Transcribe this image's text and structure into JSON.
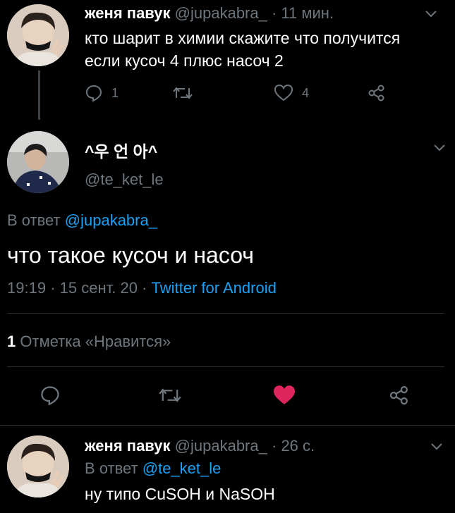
{
  "tweet1": {
    "name": "женя павук",
    "handle": "@jupakabra_",
    "separator": "·",
    "time": "11 мин.",
    "text_line1": "кто шарит в химии скажите что получится",
    "text_line2": "если кусоч 4 плюс насоч 2",
    "reply_count": "1",
    "like_count": "4"
  },
  "main_tweet": {
    "name": "^우 언 아^",
    "handle": "@te_ket_le",
    "reply_prefix": "В ответ",
    "reply_to": "@jupakabra_",
    "text": "что такое кусоч и насоч",
    "time": "19:19",
    "dot1": "·",
    "date": "15 сент. 20",
    "dot2": "·",
    "client": "Twitter for Android",
    "likes_count": "1",
    "likes_label": "Отметка «Нравится»"
  },
  "reply": {
    "name": "женя павук",
    "handle": "@jupakabra_",
    "separator": "·",
    "time": "26 с.",
    "reply_prefix": "В ответ",
    "reply_to": "@te_ket_le",
    "text": "ну типо CuSOH и NaSOH"
  },
  "colors": {
    "background": "#000000",
    "text": "#ffffff",
    "muted": "#6e767d",
    "link": "#1da1f2",
    "liked_heart": "#e0245e"
  },
  "icons": [
    "reply-icon",
    "retweet-icon",
    "like-icon",
    "share-icon",
    "chevron-down-icon"
  ]
}
